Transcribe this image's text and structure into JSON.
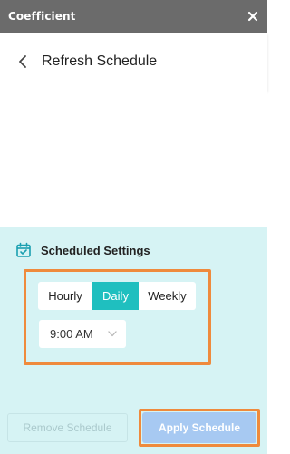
{
  "titlebar": {
    "app_title": "Coefficient",
    "close_icon": "close-icon"
  },
  "header": {
    "back_icon": "chevron-left-icon",
    "title": "Refresh Schedule"
  },
  "schedule": {
    "section_icon": "calendar-check-icon",
    "section_title": "Scheduled Settings",
    "frequency_options": [
      "Hourly",
      "Daily",
      "Weekly"
    ],
    "selected_frequency": "Daily",
    "time_value": "9:00 AM",
    "time_icon": "chevron-down-icon"
  },
  "actions": {
    "remove_label": "Remove Schedule",
    "apply_label": "Apply Schedule"
  },
  "colors": {
    "titlebar_bg": "#6b6b6b",
    "panel_bg": "#d6f3f4",
    "accent_teal": "#1fbfbf",
    "highlight_orange": "#ef8a3c",
    "apply_button_bg": "#a7c9f2"
  }
}
